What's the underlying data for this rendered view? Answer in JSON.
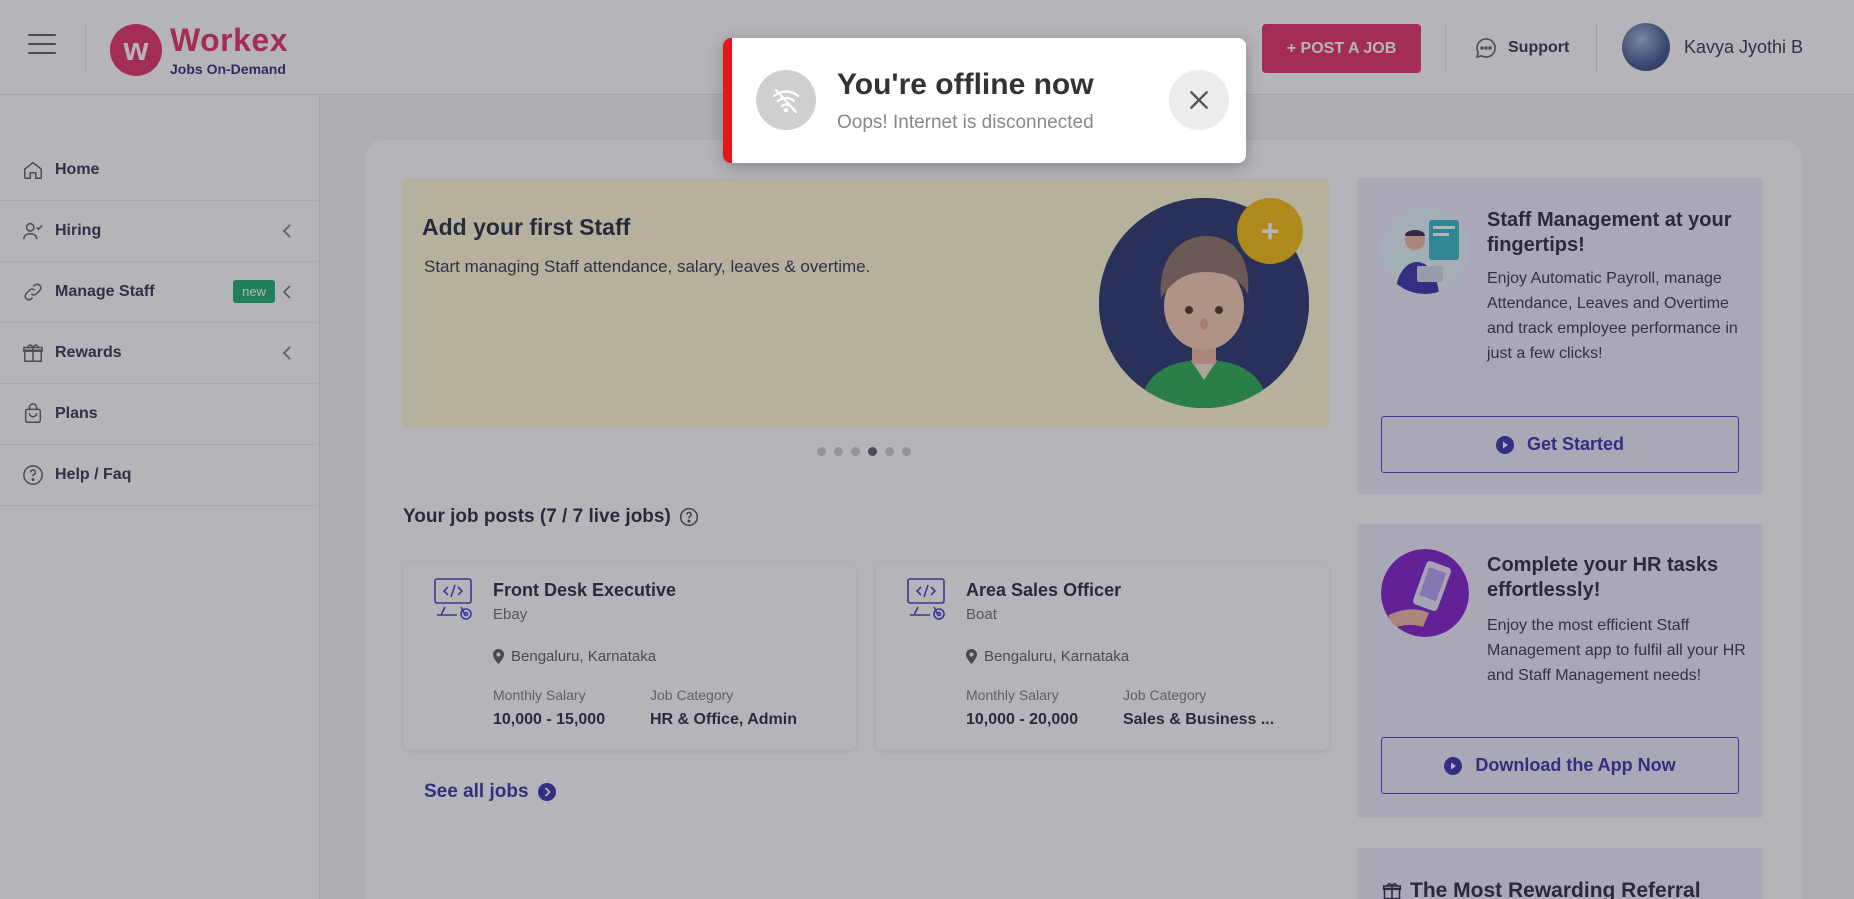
{
  "header": {
    "logo_mark": "w",
    "logo_name": "Workex",
    "logo_tagline": "Jobs On-Demand",
    "post_job_label": "+ POST A JOB",
    "support_label": "Support",
    "user_name": "Kavya Jyothi B"
  },
  "sidebar": {
    "items": [
      {
        "label": "Home",
        "icon": "home-icon"
      },
      {
        "label": "Hiring",
        "icon": "hiring-icon",
        "expandable": true
      },
      {
        "label": "Manage Staff",
        "icon": "link-icon",
        "badge": "new",
        "expandable": true
      },
      {
        "label": "Rewards",
        "icon": "gift-icon",
        "expandable": true
      },
      {
        "label": "Plans",
        "icon": "bag-icon"
      },
      {
        "label": "Help / Faq",
        "icon": "help-icon"
      }
    ]
  },
  "banner": {
    "title": "Add your first Staff",
    "subtitle": "Start managing Staff attendance, salary, leaves & overtime.",
    "plus_label": "+",
    "carousel_dots": 6,
    "active_dot": 4
  },
  "jobs": {
    "section_title": "Your job posts (7 / 7 live jobs)",
    "salary_label": "Monthly Salary",
    "category_label": "Job Category",
    "items": [
      {
        "title": "Front Desk Executive",
        "company": "Ebay",
        "location": "Bengaluru, Karnataka",
        "salary": "10,000 - 15,000",
        "category": "HR & Office, Admin"
      },
      {
        "title": "Area Sales Officer",
        "company": "Boat",
        "location": "Bengaluru, Karnataka",
        "salary": "10,000 - 20,000",
        "category": "Sales & Business ..."
      }
    ],
    "see_all_label": "See all jobs"
  },
  "promo_cards": [
    {
      "title": "Staff Management at your fingertips!",
      "text": "Enjoy Automatic Payroll, manage Attendance, Leaves and Overtime and track employee performance in just a few clicks!",
      "button": "Get Started"
    },
    {
      "title": "Complete your HR tasks effortlessly!",
      "text": "Enjoy the most efficient Staff Management app to fulfil all your HR and Staff Management needs!",
      "button": "Download the App Now"
    }
  ],
  "referral_title": "The Most Rewarding Referral",
  "toast": {
    "title": "You're offline now",
    "message": "Oops! Internet is disconnected"
  },
  "colors": {
    "brand": "#e2245d",
    "accent": "#2d28a6",
    "toast_accent": "#e8141c",
    "badge": "#12a86a",
    "banner_bg": "#fff9d2",
    "card_bg": "#edeafc"
  }
}
